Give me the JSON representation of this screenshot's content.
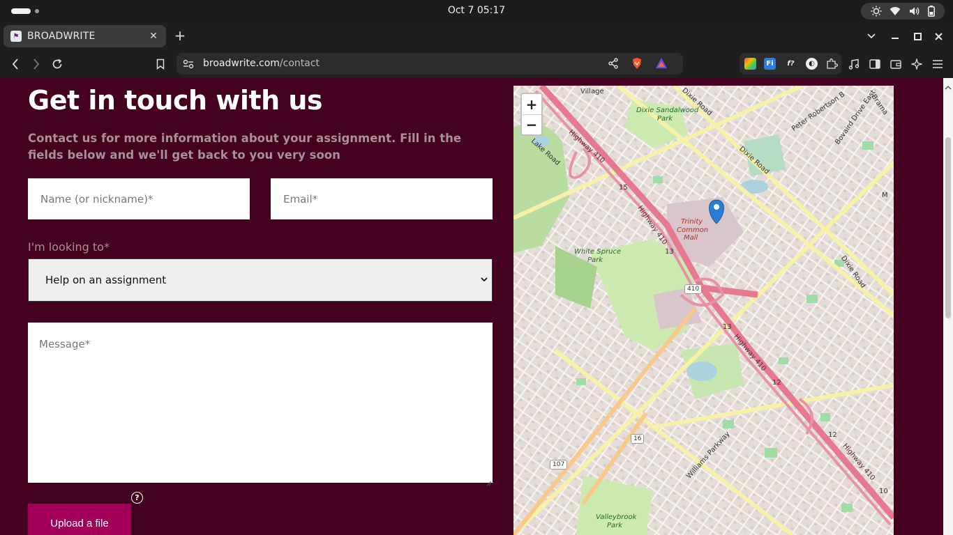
{
  "os": {
    "clock": "Oct 7  05:17"
  },
  "browser": {
    "tab_title": "BROADWRITE",
    "url_host": "broadwrite.com",
    "url_path": "/contact"
  },
  "page": {
    "heading": "Get in touch with us",
    "subtext": "Contact us for more information about your assignment. Fill in the fields below and we'll get back to you very soon",
    "name_placeholder": "Name (or nickname)*",
    "email_placeholder": "Email*",
    "looking_label": "I'm looking to*",
    "looking_value": "Help on an assignment",
    "message_placeholder": "Message*",
    "help_glyph": "?",
    "upload_label": "Upload a file"
  },
  "map": {
    "zoom_in": "+",
    "zoom_out": "−",
    "labels": {
      "village": "Village",
      "dixie_road_1": "Dixie Road",
      "dixie_road_2": "Dixie Road",
      "dixie_road_3": "Dixie Road",
      "dixie_sandalwood": "Dixie Sandalwood",
      "park_1": "Park",
      "peter_robertson": "Peter Robertson B",
      "bovaird": "Bovaird Drive East",
      "brama": "Brama",
      "lake_road": "Lake Road",
      "highway_410_a": "Highway 410",
      "highway_410_b": "Highway 410",
      "highway_410_c": "Highway 410",
      "highway_410_d": "Highway 410",
      "trinity": "Trinity",
      "common": "Common",
      "mall": "Mall",
      "white_spruce": "White Spruce",
      "park_2": "Park",
      "williams": "Williams Parkway",
      "valleybrook": "Valleybrook",
      "park_3": "Park",
      "n15": "15",
      "n13a": "13",
      "n13b": "13",
      "n12a": "12",
      "n12b": "12",
      "n10": "10",
      "s410": "410",
      "s16": "16",
      "s107": "107",
      "m": "M"
    }
  }
}
